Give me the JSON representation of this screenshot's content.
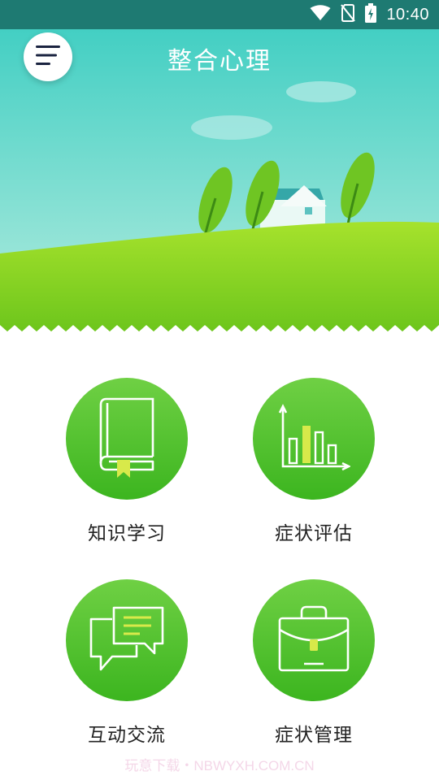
{
  "status_bar": {
    "time": "10:40",
    "icons": [
      "wifi-icon",
      "no-sim-icon",
      "battery-charging-icon"
    ]
  },
  "header": {
    "title": "整合心理",
    "menu_icon": "menu-icon"
  },
  "colors": {
    "status_bar": "#1e7a72",
    "sky_top": "#47d1c4",
    "sky_bottom": "#9ee6d8",
    "grass": "#7ed321",
    "tile_green": "#4cbf2a",
    "accent_yellow": "#c8e04a"
  },
  "menu": {
    "items": [
      {
        "label": "知识学习",
        "icon": "book-icon"
      },
      {
        "label": "症状评估",
        "icon": "bar-chart-icon"
      },
      {
        "label": "互动交流",
        "icon": "chat-bubbles-icon"
      },
      {
        "label": "症状管理",
        "icon": "briefcase-icon"
      }
    ]
  },
  "watermark": "玩意下载・NBWYXH.COM.CN"
}
